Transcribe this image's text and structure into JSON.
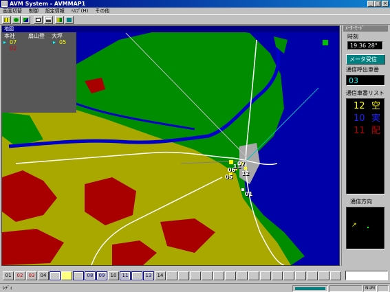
{
  "window": {
    "title": "AVM System - AVMMAP1"
  },
  "menu": [
    "画面切替",
    "制御",
    "設定情報",
    "ﾍﾙﾌﾟ(H)",
    "その他"
  ],
  "toolbar_icons": [
    "grid-icon",
    "globe-icon",
    "map-icon",
    "document-icon",
    "printer-icon",
    "settings-icon",
    "exit-icon"
  ],
  "map": {
    "caption": "地図",
    "overlay": {
      "headers": [
        "本社",
        "扇山登",
        "大坪"
      ],
      "values": [
        "07",
        "05"
      ],
      "red_value": "02"
    },
    "vehicle_labels": [
      "07",
      "06",
      "05",
      "12",
      "01",
      "11"
    ],
    "colors": {
      "sea": "#0000a8",
      "lowland": "#008c00",
      "hill": "#a8a800",
      "mountain": "#a80000",
      "urban": "#a8a8a8",
      "road": "#ffffff",
      "river": "#0000c8"
    }
  },
  "side_panel": {
    "caption": "ﾒｰﾀｰﾓｰﾄﾞ",
    "time_label": "時刻",
    "time_value": "19:36 28\"",
    "meter_button": "メータ受信",
    "call_label": "通信呼出車番",
    "call_value": "03",
    "list_label": "通信車番リスト",
    "list": [
      {
        "num": "12",
        "status": "空",
        "color": "#ffff00"
      },
      {
        "num": "10",
        "status": "実",
        "color": "#2020ff"
      },
      {
        "num": "11",
        "status": "配",
        "color": "#b00000"
      }
    ],
    "direction_label": "通信方向"
  },
  "vehicle_strip": [
    {
      "label": "01",
      "color": "#000000",
      "ring": false
    },
    {
      "label": "02",
      "color": "#c00000",
      "ring": false
    },
    {
      "label": "03",
      "color": "#c00000",
      "ring": false
    },
    {
      "label": "04",
      "color": "#000000",
      "ring": false
    },
    {
      "label": "",
      "color": "#000000",
      "ring": true
    },
    {
      "label": "",
      "color": "#000000",
      "ring": false,
      "fill": "#ffff80"
    },
    {
      "label": "",
      "color": "#000000",
      "ring": true
    },
    {
      "label": "08",
      "color": "#000080",
      "ring": true
    },
    {
      "label": "09",
      "color": "#000080",
      "ring": true
    },
    {
      "label": "10",
      "color": "#000000",
      "ring": false
    },
    {
      "label": "11",
      "color": "#000080",
      "ring": true
    },
    {
      "label": "",
      "color": "#000000",
      "ring": true
    },
    {
      "label": "13",
      "color": "#000080",
      "ring": true
    },
    {
      "label": "14",
      "color": "#000000",
      "ring": false
    }
  ],
  "status": {
    "text": "ﾚﾃﾞｨ",
    "num": "NUM"
  }
}
